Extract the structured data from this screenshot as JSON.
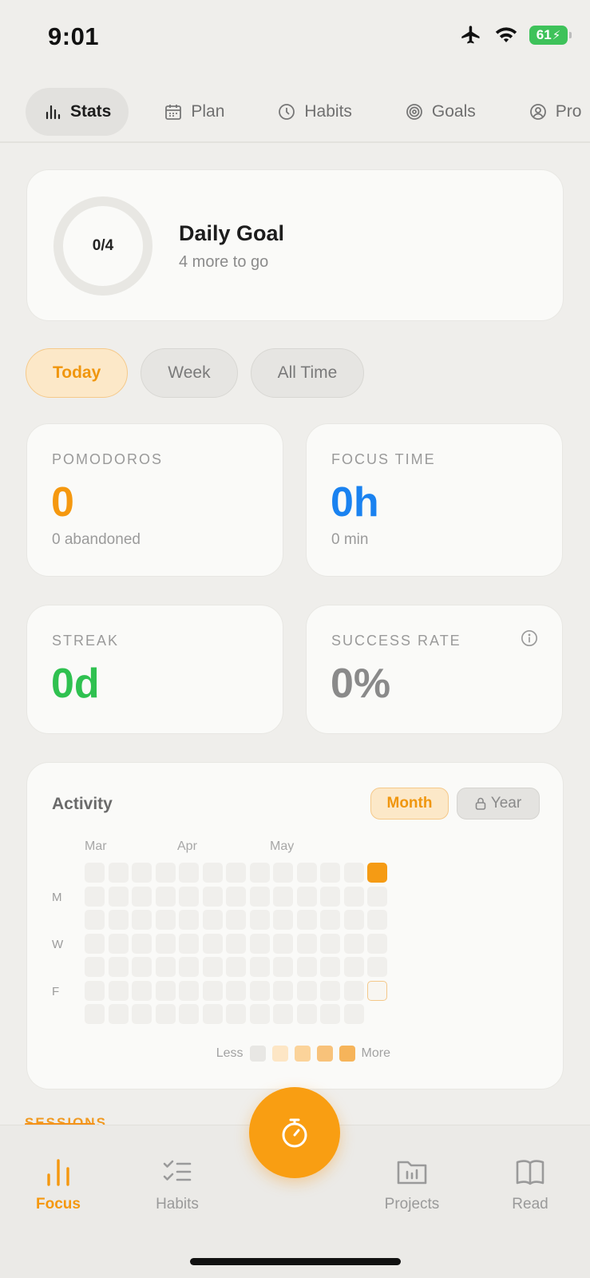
{
  "status_bar": {
    "time": "9:01",
    "battery": "61"
  },
  "top_tabs": [
    {
      "label": "Stats",
      "icon": "bar-chart-icon",
      "active": true
    },
    {
      "label": "Plan",
      "icon": "calendar-icon",
      "active": false
    },
    {
      "label": "Habits",
      "icon": "clock-icon",
      "active": false
    },
    {
      "label": "Goals",
      "icon": "target-icon",
      "active": false
    },
    {
      "label": "Pro",
      "icon": "profile-icon",
      "active": false
    }
  ],
  "daily_goal": {
    "progress_label": "0/4",
    "progress_fraction": 0,
    "title": "Daily Goal",
    "subtitle": "4 more to go"
  },
  "period_tabs": [
    {
      "label": "Today",
      "active": true
    },
    {
      "label": "Week",
      "active": false
    },
    {
      "label": "All Time",
      "active": false
    }
  ],
  "stats": {
    "pomodoros": {
      "label": "POMODOROS",
      "value": "0",
      "sub": "0 abandoned",
      "color": "#f5980f"
    },
    "focus_time": {
      "label": "FOCUS TIME",
      "value": "0h",
      "sub": "0 min",
      "color": "#1a82f0"
    },
    "streak": {
      "label": "STREAK",
      "value": "0d",
      "color": "#2fc150"
    },
    "success_rate": {
      "label": "SUCCESS RATE",
      "value": "0%",
      "color": "#8a8a8a"
    }
  },
  "activity": {
    "title": "Activity",
    "ranges": [
      {
        "label": "Month",
        "active": true
      },
      {
        "label": "Year",
        "locked": true
      }
    ],
    "months": [
      "Mar",
      "Apr",
      "May"
    ],
    "day_labels": [
      "M",
      "W",
      "F"
    ],
    "legend_less": "Less",
    "legend_more": "More",
    "legend_colors": [
      "#e8e7e4",
      "#fde6c5",
      "#fbd39a",
      "#f8c27a",
      "#f6b45a"
    ],
    "accent": "#f59b14"
  },
  "sessions_header": "SESSIONS",
  "bottom_nav": [
    {
      "label": "Focus",
      "icon": "bar-chart-icon",
      "active": true
    },
    {
      "label": "Habits",
      "icon": "checklist-icon",
      "active": false
    },
    {
      "label": "Projects",
      "icon": "folder-icon",
      "active": false
    },
    {
      "label": "Read",
      "icon": "book-icon",
      "active": false
    }
  ],
  "fab_icon": "stopwatch-icon"
}
